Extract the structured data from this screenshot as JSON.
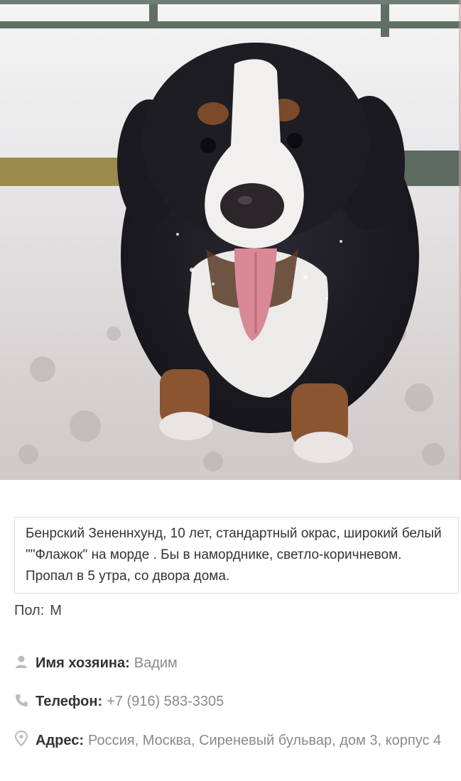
{
  "listing": {
    "description": "Бенрский Зененнхунд, 10 лет, стандартный окрас, широкий белый \"\"Флажок\" на морде . Бы в наморднике, светло-коричневом. Пропал в 5 утра, со двора дома.",
    "gender_label": "Пол:",
    "gender_value": "М"
  },
  "contact": {
    "owner_label": "Имя хозяина:",
    "owner_value": "Вадим",
    "phone_label": "Телефон:",
    "phone_value": "+7 (916) 583-3305",
    "address_label": "Адрес:",
    "address_value": "Россия, Москва, Сиреневый бульвар, дом 3, корпус 4"
  },
  "icons": {
    "owner": "person-icon",
    "phone": "phone-icon",
    "address": "map-pin-icon"
  },
  "colors": {
    "icon": "#bdbdbd",
    "label": "#333333",
    "value": "#8a8a8a",
    "border": "#dcdcdc"
  }
}
